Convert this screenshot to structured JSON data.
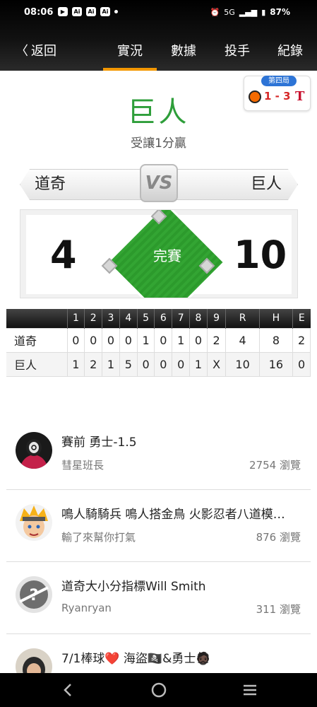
{
  "status_bar": {
    "time": "08:06",
    "app_icons": [
      "youtube-icon",
      "ai-icon",
      "ai-icon",
      "ai-icon"
    ],
    "network": "5G",
    "battery": "87%"
  },
  "nav": {
    "back_label": "返回",
    "tabs": [
      {
        "label": "實況",
        "active": true
      },
      {
        "label": "數據",
        "active": false
      },
      {
        "label": "投手",
        "active": false
      },
      {
        "label": "紀錄",
        "active": false
      }
    ],
    "accent_color": "#f39800"
  },
  "header": {
    "pick_team": "巨人",
    "handicap_text": "受讓1分贏"
  },
  "live_badge": {
    "inning": "第四局",
    "score": "1 - 3"
  },
  "matchup": {
    "away_team": "道奇",
    "home_team": "巨人",
    "vs_label": "VS",
    "away_score": "4",
    "home_score": "10",
    "status": "完賽"
  },
  "line_score": {
    "headers": [
      "",
      "1",
      "2",
      "3",
      "4",
      "5",
      "6",
      "7",
      "8",
      "9",
      "R",
      "H",
      "E"
    ],
    "rows": [
      {
        "team": "道奇",
        "cells": [
          "0",
          "0",
          "0",
          "0",
          "1",
          "0",
          "1",
          "0",
          "2",
          "4",
          "8",
          "2"
        ]
      },
      {
        "team": "巨人",
        "cells": [
          "1",
          "2",
          "1",
          "5",
          "0",
          "0",
          "0",
          "1",
          "X",
          "10",
          "16",
          "0"
        ]
      }
    ]
  },
  "posts": [
    {
      "title": "賽前 勇士-1.5",
      "author": "彗星班長",
      "views": "2754 瀏覽",
      "avatar": "red-hoodie-avatar"
    },
    {
      "title": "鳴人騎騎兵 鳴人搭金鳥 火影忍者八道模…",
      "author": "輸了來幫你打氣",
      "views": "876 瀏覽",
      "avatar": "naruto-avatar"
    },
    {
      "title": "道奇大小分指標Will Smith",
      "author": "Ryanryan",
      "views": "311 瀏覽",
      "avatar": "unknown-avatar"
    },
    {
      "title": "7/1棒球❤️ 海盜🏴‍☠️&勇士🧔🏿",
      "author": "",
      "views": "",
      "avatar": "photo-avatar"
    }
  ]
}
